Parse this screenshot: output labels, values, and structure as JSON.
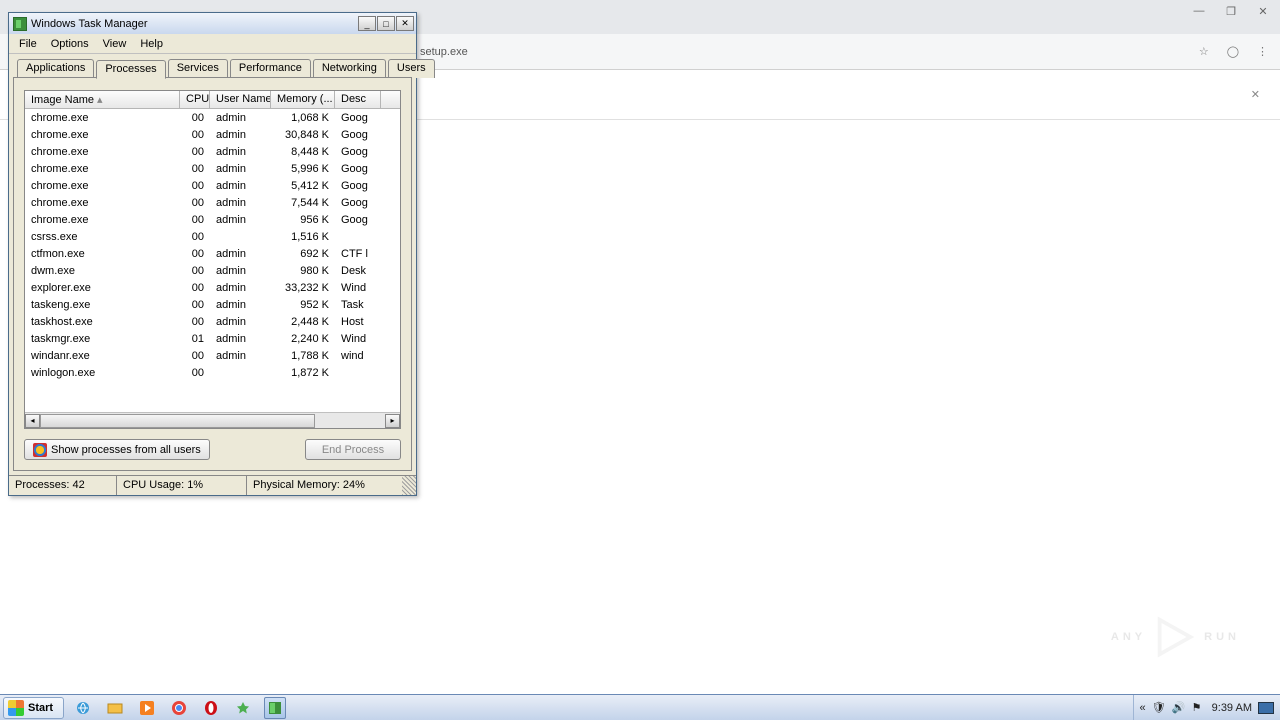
{
  "chrome": {
    "addr_fragment": "setup.exe",
    "close_x": "✕"
  },
  "tm": {
    "title": "Windows Task Manager",
    "menu": [
      "File",
      "Options",
      "View",
      "Help"
    ],
    "tabs": [
      "Applications",
      "Processes",
      "Services",
      "Performance",
      "Networking",
      "Users"
    ],
    "active_tab": 1,
    "cols": {
      "image": "Image Name",
      "cpu": "CPU",
      "user": "User Name",
      "mem": "Memory (...",
      "desc": "Desc"
    },
    "rows": [
      {
        "image": "chrome.exe",
        "cpu": "00",
        "user": "admin",
        "mem": "1,068 K",
        "desc": "Goog"
      },
      {
        "image": "chrome.exe",
        "cpu": "00",
        "user": "admin",
        "mem": "30,848 K",
        "desc": "Goog"
      },
      {
        "image": "chrome.exe",
        "cpu": "00",
        "user": "admin",
        "mem": "8,448 K",
        "desc": "Goog"
      },
      {
        "image": "chrome.exe",
        "cpu": "00",
        "user": "admin",
        "mem": "5,996 K",
        "desc": "Goog"
      },
      {
        "image": "chrome.exe",
        "cpu": "00",
        "user": "admin",
        "mem": "5,412 K",
        "desc": "Goog"
      },
      {
        "image": "chrome.exe",
        "cpu": "00",
        "user": "admin",
        "mem": "7,544 K",
        "desc": "Goog"
      },
      {
        "image": "chrome.exe",
        "cpu": "00",
        "user": "admin",
        "mem": "956 K",
        "desc": "Goog"
      },
      {
        "image": "csrss.exe",
        "cpu": "00",
        "user": "",
        "mem": "1,516 K",
        "desc": ""
      },
      {
        "image": "ctfmon.exe",
        "cpu": "00",
        "user": "admin",
        "mem": "692 K",
        "desc": "CTF l"
      },
      {
        "image": "dwm.exe",
        "cpu": "00",
        "user": "admin",
        "mem": "980 K",
        "desc": "Desk"
      },
      {
        "image": "explorer.exe",
        "cpu": "00",
        "user": "admin",
        "mem": "33,232 K",
        "desc": "Wind"
      },
      {
        "image": "taskeng.exe",
        "cpu": "00",
        "user": "admin",
        "mem": "952 K",
        "desc": "Task"
      },
      {
        "image": "taskhost.exe",
        "cpu": "00",
        "user": "admin",
        "mem": "2,448 K",
        "desc": "Host"
      },
      {
        "image": "taskmgr.exe",
        "cpu": "01",
        "user": "admin",
        "mem": "2,240 K",
        "desc": "Wind"
      },
      {
        "image": "windanr.exe",
        "cpu": "00",
        "user": "admin",
        "mem": "1,788 K",
        "desc": "wind"
      },
      {
        "image": "winlogon.exe",
        "cpu": "00",
        "user": "",
        "mem": "1,872 K",
        "desc": ""
      }
    ],
    "btn_show_all": "Show processes from all users",
    "btn_end": "End Process",
    "status": {
      "processes": "Processes: 42",
      "cpu": "CPU Usage: 1%",
      "mem": "Physical Memory: 24%"
    }
  },
  "taskbar": {
    "start": "Start",
    "clock": "9:39 AM"
  },
  "watermark": {
    "left": "ANY",
    "right": "RUN"
  }
}
